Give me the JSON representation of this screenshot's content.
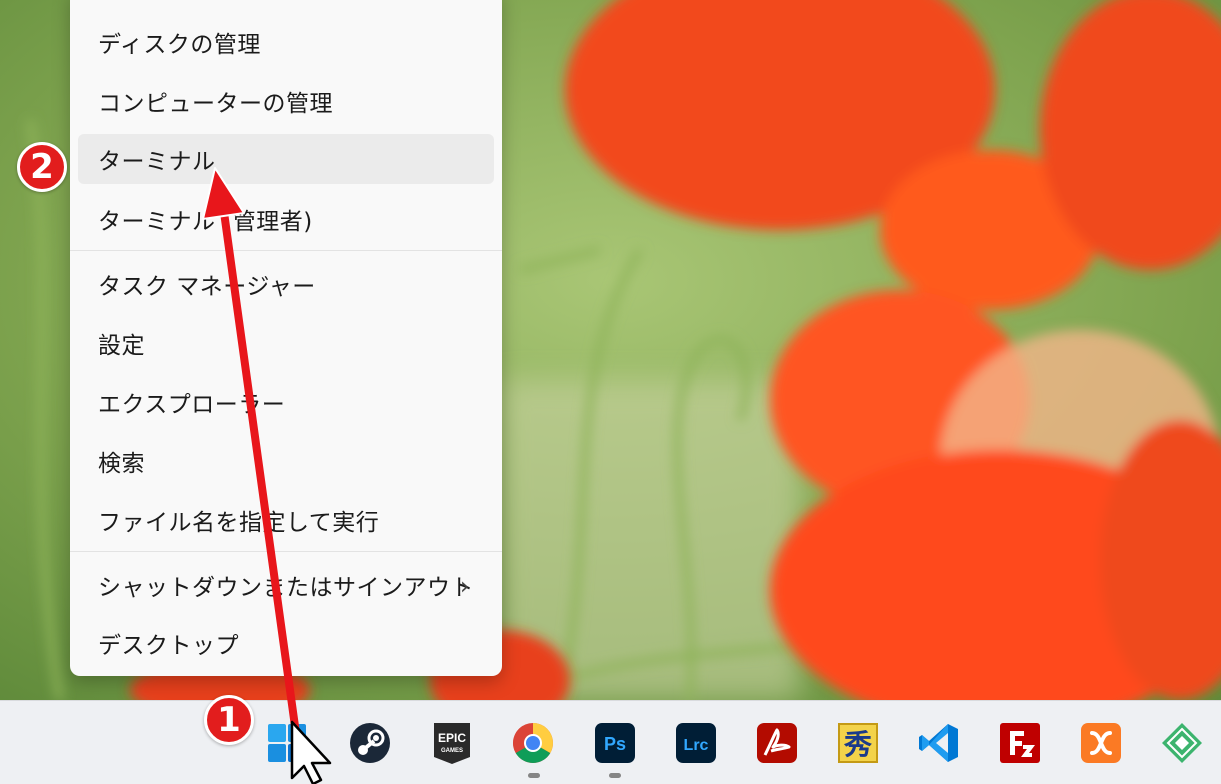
{
  "menu": {
    "items": [
      {
        "label": "ディスクの管理"
      },
      {
        "label": "コンピューターの管理"
      },
      {
        "label": "ターミナル"
      },
      {
        "label": "ターミナル (管理者)"
      },
      {
        "label": "タスク マネージャー"
      },
      {
        "label": "設定"
      },
      {
        "label": "エクスプローラー"
      },
      {
        "label": "検索"
      },
      {
        "label": "ファイル名を指定して実行"
      },
      {
        "label": "シャットダウンまたはサインアウト",
        "submenu_indicator": "›"
      },
      {
        "label": "デスクトップ"
      }
    ]
  },
  "annotations": {
    "step1": "1",
    "step2": "2",
    "arrow_color": "#e8161b"
  },
  "taskbar": {
    "icons": [
      {
        "name": "windows-start-icon"
      },
      {
        "name": "steam-icon"
      },
      {
        "name": "epic-games-icon",
        "label_top": "EPIC",
        "label_bottom": "GAMES"
      },
      {
        "name": "chrome-icon"
      },
      {
        "name": "photoshop-icon",
        "label": "Ps"
      },
      {
        "name": "lightroom-classic-icon",
        "label": "Lrc"
      },
      {
        "name": "acrobat-icon"
      },
      {
        "name": "hidemaru-editor-icon",
        "label": "秀"
      },
      {
        "name": "vscode-icon"
      },
      {
        "name": "filezilla-icon"
      },
      {
        "name": "xampp-icon"
      },
      {
        "name": "green-diamond-app-icon"
      }
    ]
  },
  "colors": {
    "menu_bg": "#f9f9f9",
    "hover_bg": "#ebebeb",
    "taskbar_bg": "#eef0f3",
    "badge_red": "#e21d1d"
  }
}
